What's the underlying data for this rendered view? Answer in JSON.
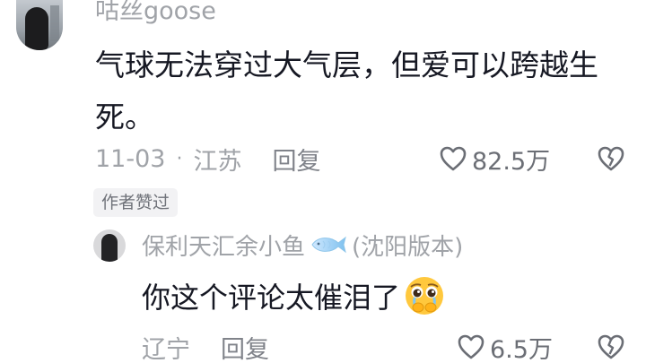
{
  "comment": {
    "username": "咕丝goose",
    "text": "气球无法穿过大气层，但爱可以跨越生死。",
    "date": "11-03",
    "separator": "·",
    "location": "江苏",
    "reply_label": "回复",
    "likes": "82.5万",
    "author_badge": "作者赞过",
    "avatar_icon": "user-avatar",
    "like_icon": "heart-outline-icon",
    "dislike_icon": "broken-heart-icon"
  },
  "reply": {
    "username_prefix": "保利天汇余小鱼",
    "username_suffix": "(沈阳版本)",
    "text": "你这个评论太催泪了",
    "emoji": "pleading-face-emoji",
    "location": "辽宁",
    "reply_label": "回复",
    "likes": "6.5万",
    "badge_icon": "fish-icon"
  },
  "colors": {
    "text_primary": "#161823",
    "text_secondary": "#a0a3a8",
    "badge_bg": "#f2f2f4"
  }
}
